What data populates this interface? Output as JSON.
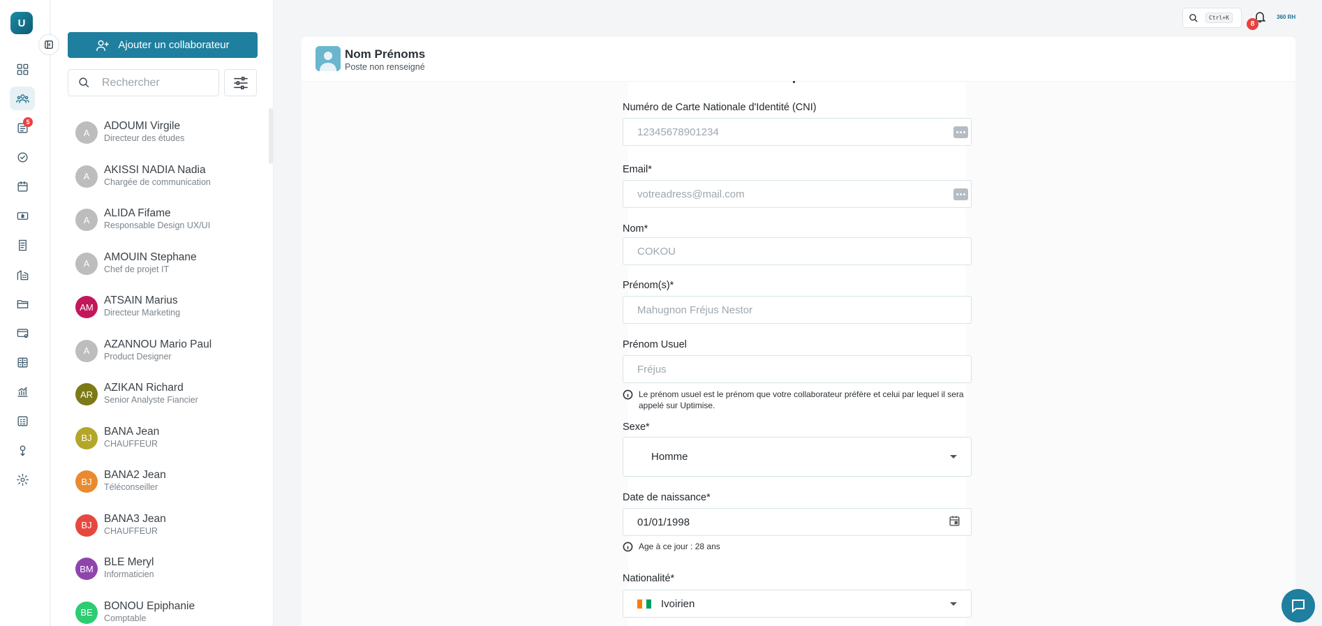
{
  "brand": {
    "logo_letter": "U",
    "mini_logo": "360 RH"
  },
  "rail": {
    "items": [
      {
        "name": "dashboard-icon"
      },
      {
        "name": "team-icon",
        "active": true
      },
      {
        "name": "requests-icon",
        "badge": "5"
      },
      {
        "name": "approval-icon"
      },
      {
        "name": "calendar-icon"
      },
      {
        "name": "payroll-icon"
      },
      {
        "name": "contracts-icon"
      },
      {
        "name": "company-icon"
      },
      {
        "name": "folder-icon"
      },
      {
        "name": "cards-icon"
      },
      {
        "name": "calculator-icon"
      },
      {
        "name": "analytics-icon"
      },
      {
        "name": "report-icon"
      },
      {
        "name": "award-icon"
      },
      {
        "name": "settings-icon"
      }
    ]
  },
  "panel": {
    "add_button_label": "Ajouter un collaborateur",
    "search_placeholder": "Rechercher",
    "employees": [
      {
        "initials": "A",
        "name": "ADOUMI Virgile",
        "role": "Directeur des études",
        "color": "#bdbdbd"
      },
      {
        "initials": "A",
        "name": "AKISSI NADIA Nadia",
        "role": "Chargée de communication",
        "color": "#bdbdbd"
      },
      {
        "initials": "A",
        "name": "ALIDA Fifame",
        "role": "Responsable Design UX/UI",
        "color": "#bdbdbd"
      },
      {
        "initials": "A",
        "name": "AMOUIN Stephane",
        "role": "Chef de projet IT",
        "color": "#bdbdbd"
      },
      {
        "initials": "AM",
        "name": "ATSAIN Marius",
        "role": "Directeur Marketing",
        "color": "#c2185b"
      },
      {
        "initials": "A",
        "name": "AZANNOU Mario Paul",
        "role": "Product Designer",
        "color": "#bdbdbd"
      },
      {
        "initials": "AR",
        "name": "AZIKAN Richard",
        "role": "Senior Analyste Fiancier",
        "color": "#7c7a16"
      },
      {
        "initials": "BJ",
        "name": "BANA Jean",
        "role": "CHAUFFEUR",
        "color": "#b3a629"
      },
      {
        "initials": "BJ",
        "name": "BANA2 Jean",
        "role": "Téléconseiller",
        "color": "#ea8a2e"
      },
      {
        "initials": "BJ",
        "name": "BANA3 Jean",
        "role": "CHAUFFEUR",
        "color": "#e5483f"
      },
      {
        "initials": "BM",
        "name": "BLE Meryl",
        "role": "Informaticien",
        "color": "#8e44ad"
      },
      {
        "initials": "BE",
        "name": "BONOU Epiphanie",
        "role": "Comptable",
        "color": "#2ecc71"
      }
    ]
  },
  "topbar": {
    "shortcut": "Ctrl+K",
    "notification_count": "8"
  },
  "profile": {
    "name": "Nom Prénoms",
    "position": "Poste non renseigné"
  },
  "form": {
    "cni": {
      "label": "Numéro de Carte Nationale d'Identité (CNI)",
      "placeholder": "12345678901234"
    },
    "email": {
      "label": "Email*",
      "placeholder": "votreadress@mail.com"
    },
    "nom": {
      "label": "Nom*",
      "placeholder": "COKOU"
    },
    "prenoms": {
      "label": "Prénom(s)*",
      "placeholder": "Mahugnon Fréjus Nestor"
    },
    "prenom_usuel": {
      "label": "Prénom Usuel",
      "placeholder": "Fréjus",
      "hint": "Le prénom usuel est le prénom que votre collaborateur préfère et celui par lequel il sera appelé sur Uptimise."
    },
    "sexe": {
      "label": "Sexe*",
      "value": "Homme"
    },
    "date_naissance": {
      "label": "Date de naissance*",
      "value": "01/01/1998",
      "hint": "Age à ce jour : 28 ans"
    },
    "nationalite": {
      "label": "Nationalité*",
      "value": "Ivoirien",
      "flag_colors": [
        "#f77f00",
        "#ffffff",
        "#009e60"
      ]
    }
  },
  "colors": {
    "primary": "#1f7f9e",
    "badge": "#e8413f"
  }
}
